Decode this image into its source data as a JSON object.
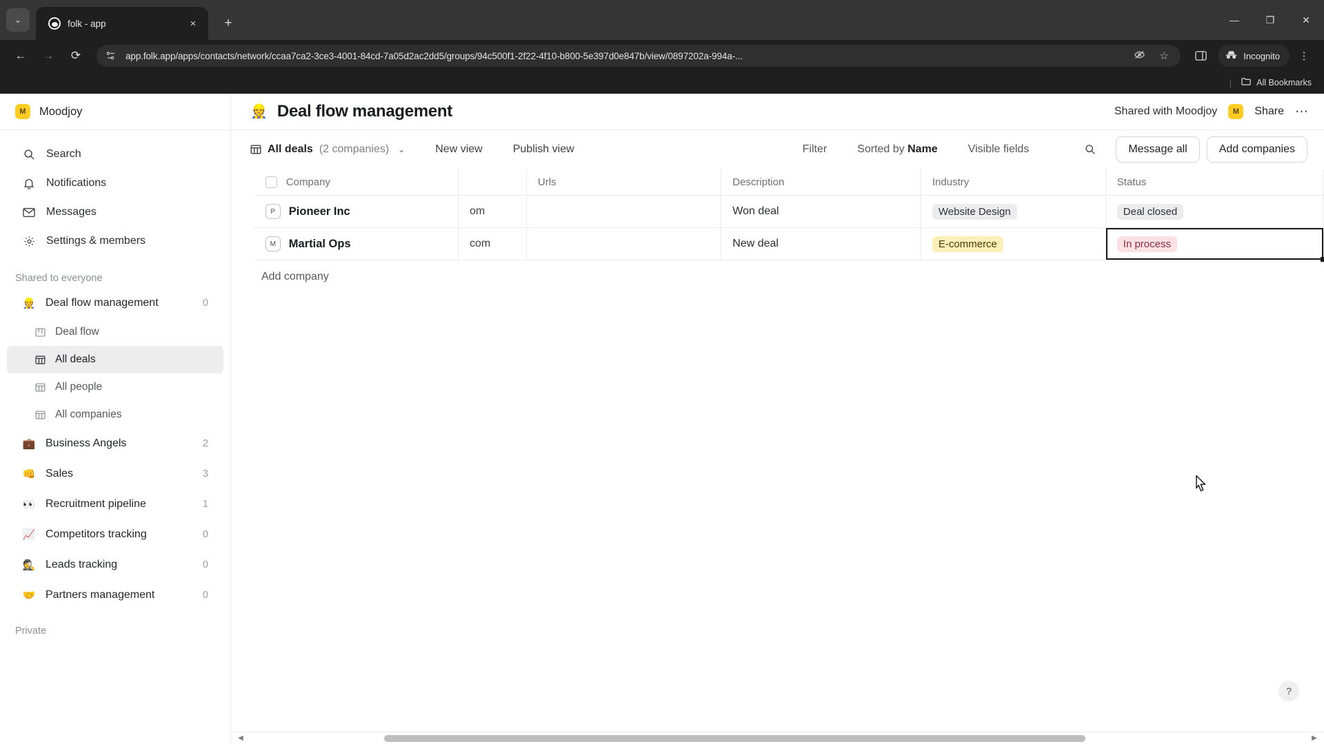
{
  "browser": {
    "tab": {
      "title": "folk - app",
      "favicon": "folk-logo-icon",
      "close": "×"
    },
    "new_tab_label": "+",
    "tab_search_label": "⌄",
    "window_controls": {
      "minimize": "—",
      "maximize": "❐",
      "close": "✕"
    },
    "nav": {
      "back": "←",
      "forward": "→",
      "reload": "⟳"
    },
    "url": "app.folk.app/apps/contacts/network/ccaa7ca2-3ce3-4001-84cd-7a05d2ac2dd5/groups/94c500f1-2f22-4f10-b800-5e397d0e847b/view/0897202a-994a-...",
    "site_info_icon": "site-settings-icon",
    "tracking_protection_icon": "eye-crossed-icon",
    "bookmark_icon": "star-icon",
    "side_panel_icon": "side-panel-icon",
    "incognito_label": "Incognito",
    "incognito_icon": "incognito-hat-icon",
    "menu_icon": "three-dot-menu-icon",
    "bookmarks_bar": {
      "separator": "|",
      "all_bookmarks_label": "All Bookmarks",
      "folder_icon": "folder-icon"
    }
  },
  "sidebar": {
    "workspace": {
      "name": "Moodjoy",
      "avatar_letter": "M",
      "avatar_color": "#FFCC26"
    },
    "nav_items": [
      {
        "label": "Search",
        "icon": "search-icon"
      },
      {
        "label": "Notifications",
        "icon": "bell-icon"
      },
      {
        "label": "Messages",
        "icon": "envelope-icon"
      },
      {
        "label": "Settings & members",
        "icon": "gear-icon"
      }
    ],
    "shared_section_label": "Shared to everyone",
    "groups": [
      {
        "label": "Deal flow management",
        "emoji": "👷",
        "count": "0",
        "expanded": true,
        "children": [
          {
            "label": "Deal flow",
            "icon": "board-view-icon",
            "active": false
          },
          {
            "label": "All deals",
            "icon": "table-view-icon",
            "active": true
          },
          {
            "label": "All people",
            "icon": "table-view-icon",
            "active": false
          },
          {
            "label": "All companies",
            "icon": "table-view-icon",
            "active": false
          }
        ]
      },
      {
        "label": "Business Angels",
        "emoji": "💼",
        "count": "2",
        "children": []
      },
      {
        "label": "Sales",
        "emoji": "👊",
        "count": "3",
        "children": []
      },
      {
        "label": "Recruitment pipeline",
        "emoji": "👀",
        "count": "1",
        "children": []
      },
      {
        "label": "Competitors tracking",
        "emoji": "📈",
        "count": "0",
        "children": []
      },
      {
        "label": "Leads tracking",
        "emoji": "🕵️",
        "count": "0",
        "children": []
      },
      {
        "label": "Partners management",
        "emoji": "🤝",
        "count": "0",
        "children": []
      }
    ],
    "private_section_label": "Private"
  },
  "header": {
    "emoji": "👷",
    "title": "Deal flow management",
    "shared_with_label": "Shared with Moodjoy",
    "shared_avatar_letter": "M",
    "share_label": "Share",
    "more_label": "⋯"
  },
  "view_bar": {
    "view_icon": "table-view-icon",
    "view_name": "All deals",
    "view_count": "(2 companies)",
    "chevron": "⌄",
    "new_view_label": "New view",
    "publish_view_label": "Publish view",
    "filter_label": "Filter",
    "sorted_by_prefix": "Sorted by ",
    "sorted_by_field": "Name",
    "visible_fields_label": "Visible fields",
    "search_icon": "search-icon",
    "message_all_label": "Message all",
    "add_companies_label": "Add companies"
  },
  "table": {
    "columns": [
      {
        "key": "company",
        "label": "Company"
      },
      {
        "key": "partial",
        "label": ""
      },
      {
        "key": "urls",
        "label": "Urls"
      },
      {
        "key": "description",
        "label": "Description"
      },
      {
        "key": "industry",
        "label": "Industry"
      },
      {
        "key": "status",
        "label": "Status"
      }
    ],
    "add_column_label": "+",
    "rows": [
      {
        "avatar_letter": "P",
        "company": "Pioneer Inc",
        "partial": "om",
        "urls": "",
        "description": "Won deal",
        "industry": "Website Design",
        "industry_style": "gray",
        "status": "Deal closed",
        "status_style": "gray",
        "status_selected": false
      },
      {
        "avatar_letter": "M",
        "company": "Martial Ops",
        "partial": "com",
        "urls": "",
        "description": "New deal",
        "industry": "E-commerce",
        "industry_style": "yellow",
        "status": "In process",
        "status_style": "pink",
        "status_selected": true
      }
    ],
    "add_company_label": "Add company"
  },
  "help_label": "?",
  "scrollbar": {
    "left_arrow": "◀",
    "right_arrow": "▶"
  },
  "colors": {
    "accent_yellow": "#FFCC26",
    "tag_gray_bg": "#ECECEC",
    "tag_yellow_bg": "#FCF0B8",
    "tag_pink_bg": "#FBE0E4",
    "selection_border": "#16181C",
    "chrome_dark": "#1F1F1F"
  }
}
